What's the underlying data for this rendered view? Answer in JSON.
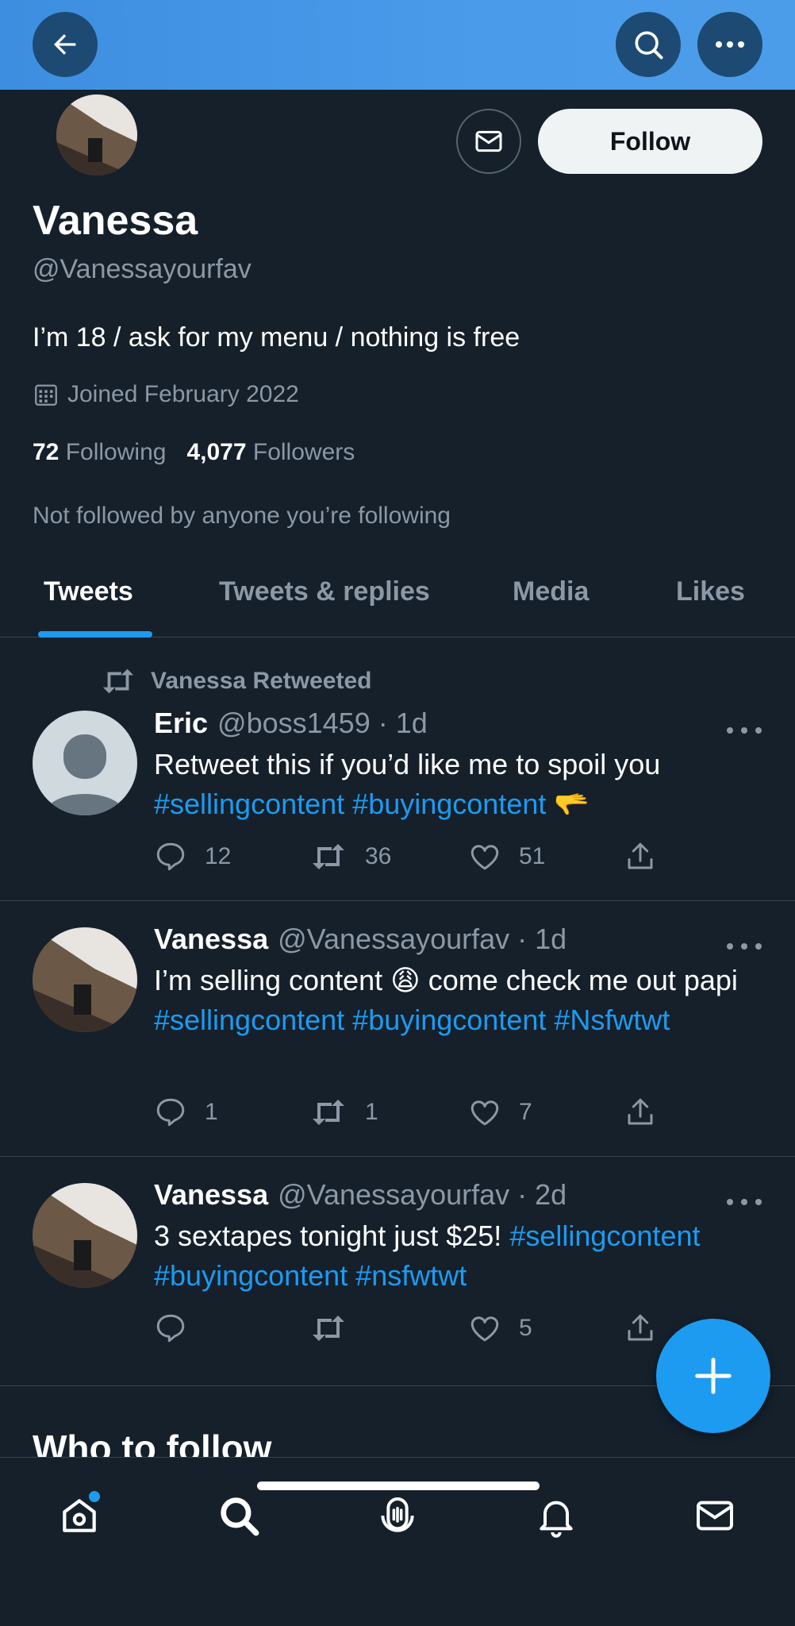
{
  "profile": {
    "name": "Vanessa",
    "handle": "@Vanessayourfav",
    "bio": "I’m 18 / ask for my menu / nothing is free",
    "joined": "Joined February 2022",
    "following_count": "72",
    "following_label": "Following",
    "followers_count": "4,077",
    "followers_label": "Followers",
    "not_followed": "Not followed by anyone you’re following",
    "follow_label": "Follow"
  },
  "tabs": [
    {
      "label": "Tweets",
      "active": true
    },
    {
      "label": "Tweets & replies"
    },
    {
      "label": "Media"
    },
    {
      "label": "Likes"
    }
  ],
  "tweets": [
    {
      "retweeted_by": "Vanessa Retweeted",
      "author": "Eric",
      "handle_time": "@boss1459 · 1d",
      "text": "Retweet this if you’d like me to spoil you",
      "tags": "#sellingcontent #buyingcontent",
      "emoji": "🫳",
      "replies": "12",
      "retweets": "36",
      "likes": "51"
    },
    {
      "author": "Vanessa",
      "handle_time": "@Vanessayourfav · 1d",
      "text": "I’m selling content",
      "emoji": "😩",
      "text2": "come check me out papi",
      "tags": "#sellingcontent #buyingcontent #Nsfwtwt",
      "replies": "1",
      "retweets": "1",
      "likes": "7"
    },
    {
      "author": "Vanessa",
      "handle_time": "@Vanessayourfav · 2d",
      "text": "3 sextapes tonight just $25!",
      "tags": "#sellingcontent #buyingcontent #nsfwtwt",
      "replies": "",
      "retweets": "",
      "likes": "5"
    }
  ],
  "who_to_follow": "Who to follow",
  "icons": {
    "back": "back-arrow-icon",
    "search": "search-icon",
    "more": "more-icon",
    "mail": "mail-icon",
    "calendar": "calendar-icon",
    "reply": "reply-icon",
    "retweet": "retweet-icon",
    "like": "heart-icon",
    "share": "share-icon",
    "compose": "plus-icon",
    "nav": [
      "home-icon",
      "search-icon",
      "spaces-icon",
      "bell-icon",
      "mail-icon"
    ]
  },
  "colors": {
    "background": "#15202b",
    "accent": "#1d9bf0",
    "banner": "#4a9bea",
    "muted": "#8b98a5"
  }
}
